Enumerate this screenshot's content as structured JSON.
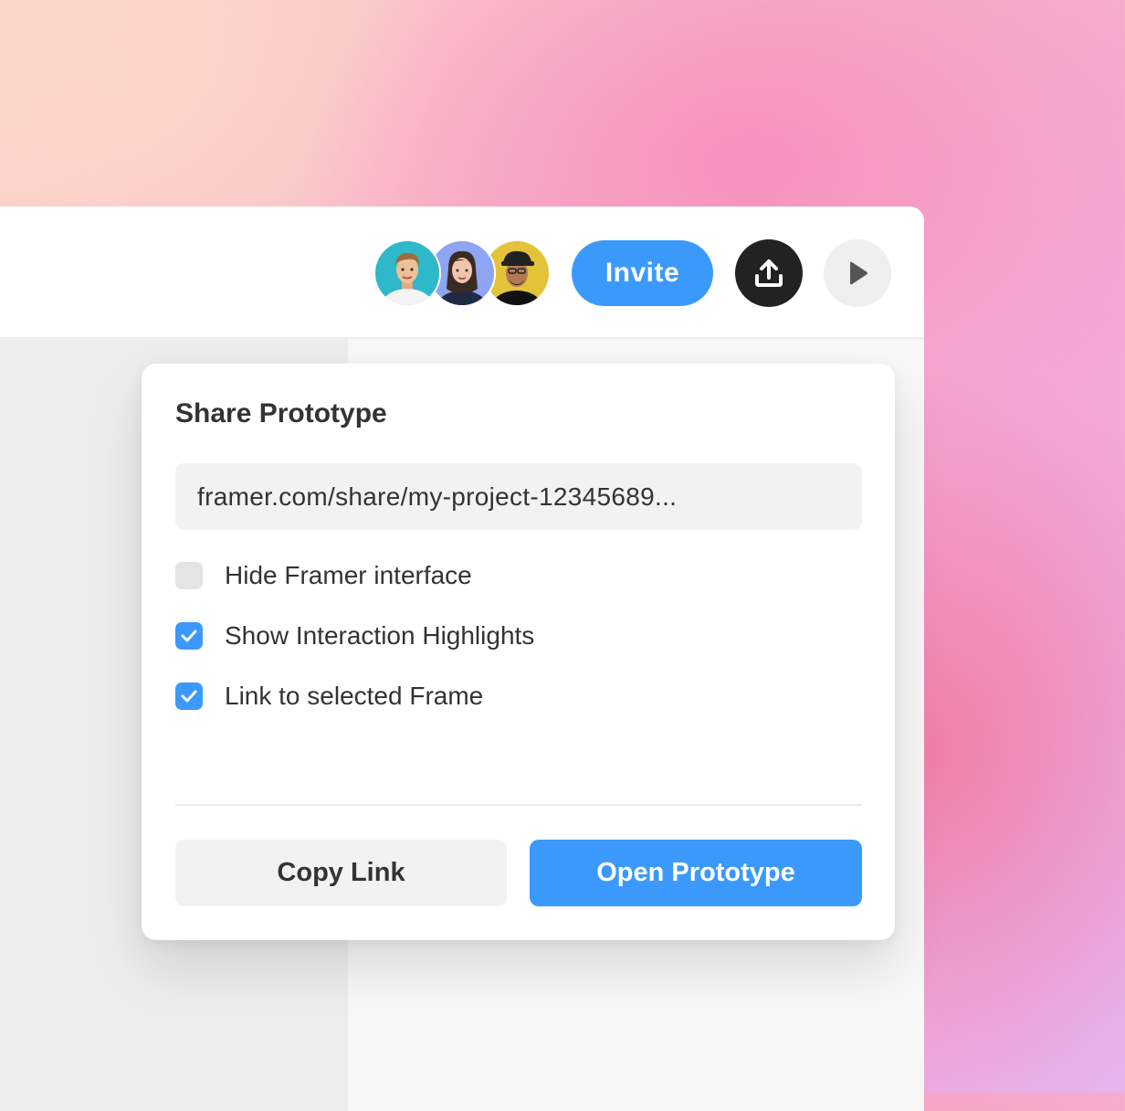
{
  "toolbar": {
    "collaborators": [
      {
        "name": "avatar-1",
        "bg": "#2eb8c9"
      },
      {
        "name": "avatar-2",
        "bg": "#8fa4f2"
      },
      {
        "name": "avatar-3",
        "bg": "#e3c33a"
      }
    ],
    "invite_label": "Invite",
    "publish_icon": "upload-icon",
    "preview_icon": "play-icon"
  },
  "share": {
    "title": "Share Prototype",
    "url": "framer.com/share/my-project-12345689...",
    "options": [
      {
        "label": "Hide Framer interface",
        "checked": false
      },
      {
        "label": "Show Interaction Highlights",
        "checked": true
      },
      {
        "label": "Link to selected Frame",
        "checked": true
      }
    ],
    "copy_label": "Copy Link",
    "open_label": "Open Prototype"
  },
  "colors": {
    "accent": "#3b99fc",
    "dark": "#222222",
    "text": "#333333"
  }
}
